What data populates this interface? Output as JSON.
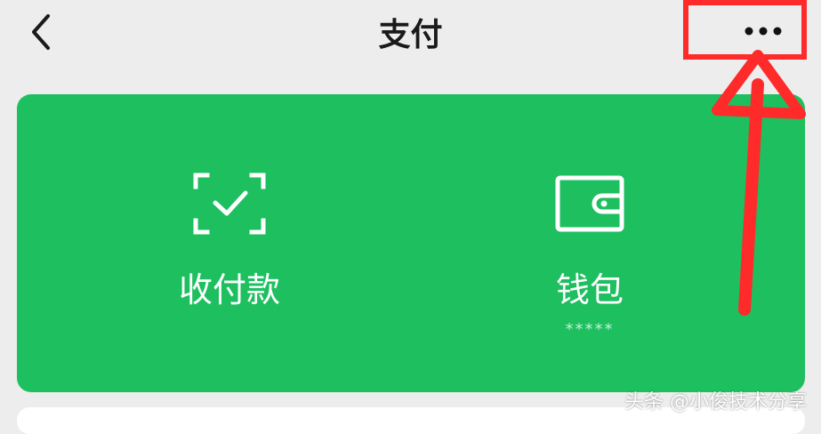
{
  "header": {
    "title": "支付",
    "back_icon": "chevron-left-icon",
    "more_icon": "more-horizontal-icon"
  },
  "card": {
    "color": "#1dbf5f",
    "items": [
      {
        "label": "收付款",
        "icon": "scan-check-icon"
      },
      {
        "label": "钱包",
        "icon": "wallet-icon",
        "balance": "*****"
      }
    ]
  },
  "annotation": {
    "highlight_color": "#ff2a2a"
  },
  "watermark": "头条 @小俊技术分享"
}
